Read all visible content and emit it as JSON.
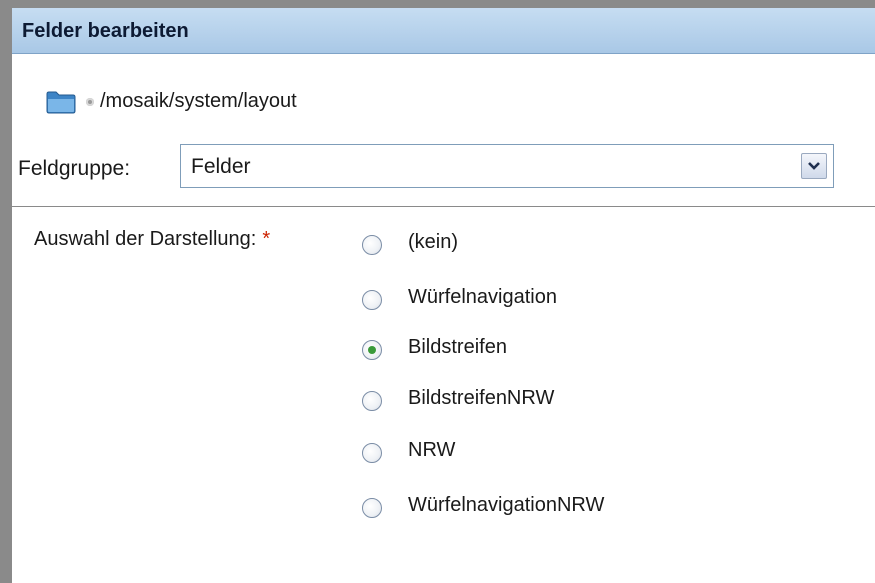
{
  "dialog": {
    "title": "Felder bearbeiten"
  },
  "path": {
    "text": "/mosaik/system/layout"
  },
  "feldgruppe": {
    "label": "Feldgruppe:",
    "selected": "Felder"
  },
  "auswahl": {
    "label": "Auswahl der Darstellung:",
    "required_mark": "*",
    "options": [
      {
        "label": "(kein)",
        "checked": false
      },
      {
        "label": "Würfelnavigation",
        "checked": false
      },
      {
        "label": "Bildstreifen",
        "checked": true
      },
      {
        "label": "BildstreifenNRW",
        "checked": false
      },
      {
        "label": "NRW",
        "checked": false
      },
      {
        "label": "WürfelnavigationNRW",
        "checked": false
      }
    ]
  },
  "colors": {
    "titlebar": "#b4d0ec",
    "required": "#cc2200",
    "radio_selected": "#3a9a3a"
  }
}
